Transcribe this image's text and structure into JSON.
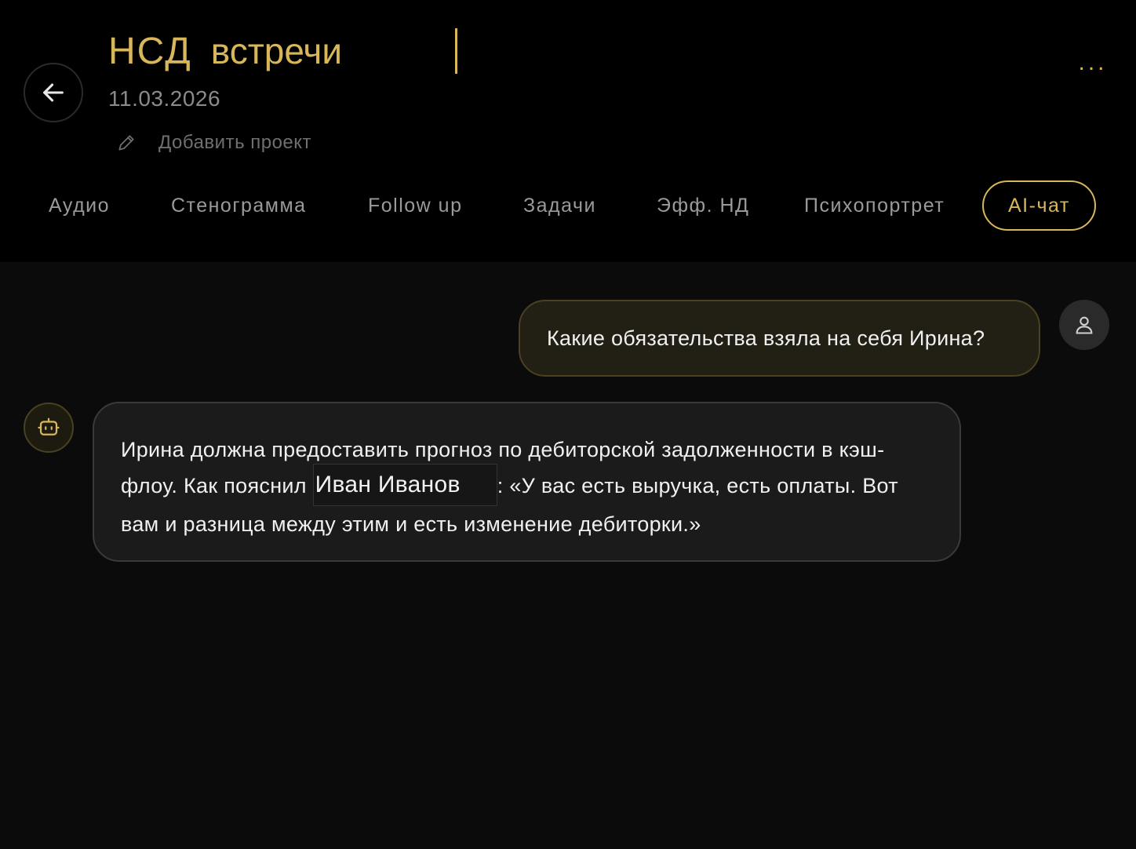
{
  "header": {
    "title_org": "НСД",
    "title_word": "встречи",
    "date": "11.03.2026",
    "add_project_label": "Добавить проект",
    "more_label": "...",
    "accent_color": "#d8b75a"
  },
  "tabs": [
    {
      "label": "Аудио",
      "active": false
    },
    {
      "label": "Стенограмма",
      "active": false
    },
    {
      "label": "Follow up",
      "active": false
    },
    {
      "label": "Задачи",
      "active": false
    },
    {
      "label": "Эфф. НД",
      "active": false
    },
    {
      "label": "Психопортрет",
      "active": false
    },
    {
      "label": "AI-чат",
      "active": true
    }
  ],
  "chat": {
    "user_message": "Какие обязательства взяла на себя Ирина?",
    "bot_message": {
      "part1": "Ирина должна предоставить прогноз по дебиторской задолженности в кэш-флоу. Как пояснил ",
      "mention": "Иван Иванов",
      "part2": ": «У вас есть выручка, есть оплаты. Вот вам и разница между этим и есть изменение дебиторки.»"
    }
  },
  "icons": {
    "back": "arrow-left-icon",
    "edit": "pencil-icon",
    "user_avatar": "user-icon",
    "bot_avatar": "robot-icon"
  }
}
